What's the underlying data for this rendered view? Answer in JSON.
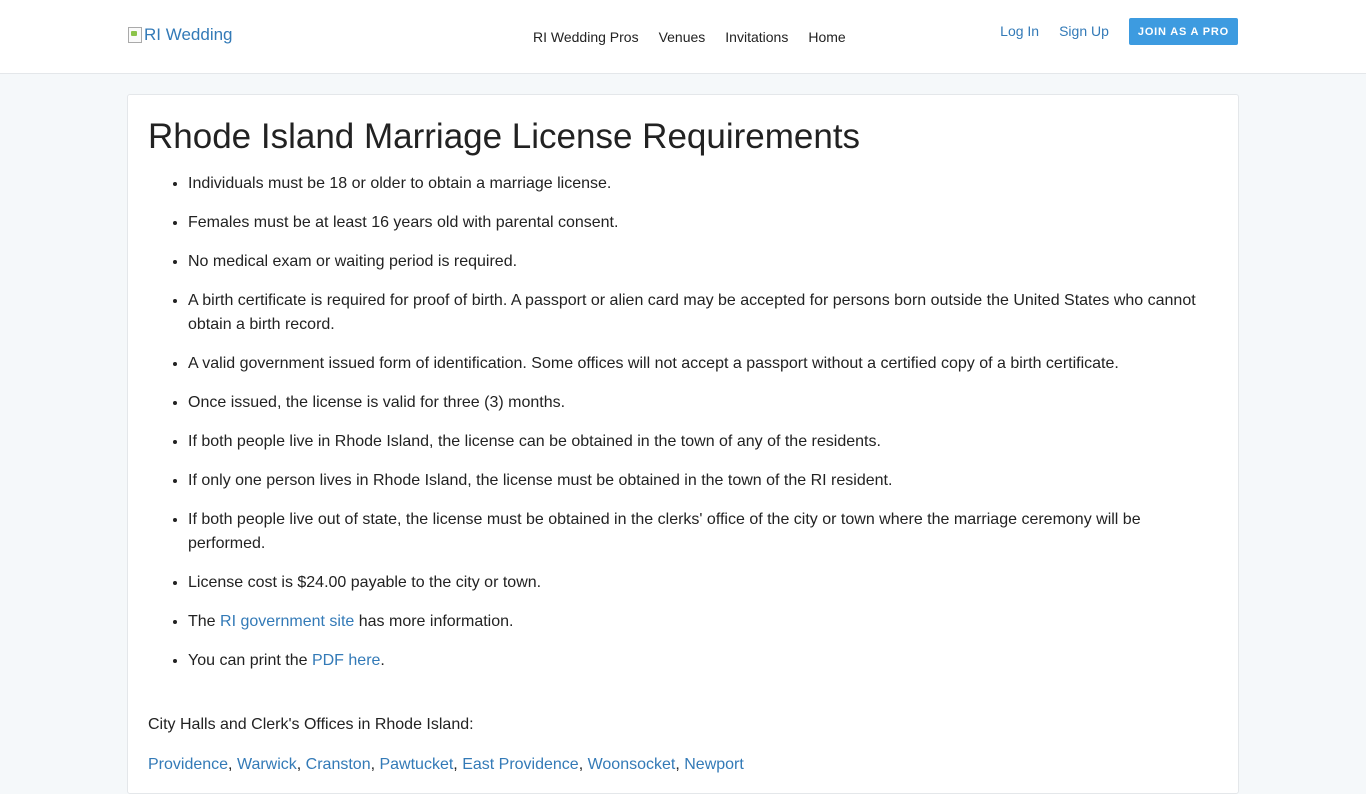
{
  "nav": {
    "logo_alt": "RI Wedding",
    "links": [
      "RI Wedding Pros",
      "Venues",
      "Invitations",
      "Home"
    ],
    "login": "Log In",
    "signup": "Sign Up",
    "join": "JOIN AS A PRO"
  },
  "main": {
    "title": "Rhode Island Marriage License Requirements",
    "requirements": [
      "Individuals must be 18 or older to obtain a marriage license.",
      "Females must be at least 16 years old with parental consent.",
      "No medical exam or waiting period is required.",
      "A birth certificate is required for proof of birth. A passport or alien card may be accepted for persons born outside the United States who cannot obtain a birth record.",
      "A valid government issued form of identification. Some offices will not accept a passport without a certified copy of a birth certificate.",
      "Once issued, the license is valid for three (3) months.",
      "If both people live in Rhode Island, the license can be obtained in the town of any of the residents.",
      "If only one person lives in Rhode Island, the license must be obtained in the town of the RI resident.",
      "If both people live out of state, the license must be obtained in the clerks' office of the city or town where the marriage ceremony will be performed.",
      "License cost is $24.00 payable to the city or town."
    ],
    "gov_item": {
      "prefix": "The ",
      "link": "RI government site",
      "suffix": " has more information."
    },
    "pdf_item": {
      "prefix": "You can print the ",
      "link": "PDF here",
      "suffix": "."
    },
    "offices_heading": "City Halls and Clerk's Offices in Rhode Island:",
    "cities": [
      "Providence",
      "Warwick",
      "Cranston",
      "Pawtucket",
      "East Providence",
      "Woonsocket",
      "Newport"
    ]
  }
}
